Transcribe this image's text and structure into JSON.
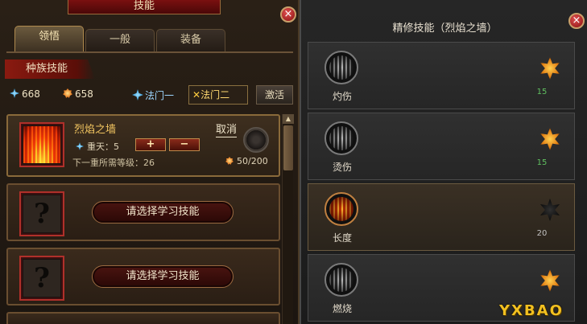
{
  "left": {
    "title": "技能",
    "tabs": [
      {
        "label": "领悟",
        "active": true
      },
      {
        "label": "一般",
        "active": false
      },
      {
        "label": "装备",
        "active": false
      }
    ],
    "race_label": "种族技能",
    "stats": {
      "blue_points": "668",
      "orange_points": "658",
      "school1": "法门一",
      "school2": "法门二",
      "activate": "激活"
    },
    "active_skill": {
      "name": "烈焰之墙",
      "cancel": "取消",
      "level": "重天：5",
      "plus": "+",
      "minus": "−",
      "next_requirement": "下一重所需等级：26",
      "points": "50/200"
    },
    "empty_slots": [
      {
        "label": "请选择学习技能",
        "icon": "?"
      },
      {
        "label": "请选择学习技能",
        "icon": "?"
      }
    ]
  },
  "right": {
    "title": "精修技能（烈焰之墙）",
    "rows": [
      {
        "name": "灼伤",
        "level": "15",
        "icon": "smoke-skill-icon",
        "star": "orange"
      },
      {
        "name": "烫伤",
        "level": "15",
        "icon": "smoke-skill-icon",
        "star": "orange"
      },
      {
        "name": "长度",
        "level": "20",
        "icon": "fire-skill-icon",
        "star": "dark"
      },
      {
        "name": "燃烧",
        "level": "",
        "icon": "smoke-skill-icon",
        "star": "orange"
      }
    ]
  },
  "watermark": "YXBAO",
  "colors": {
    "accent_red": "#8a1a10",
    "gold_text": "#f2c560",
    "green_level": "#60c060"
  }
}
